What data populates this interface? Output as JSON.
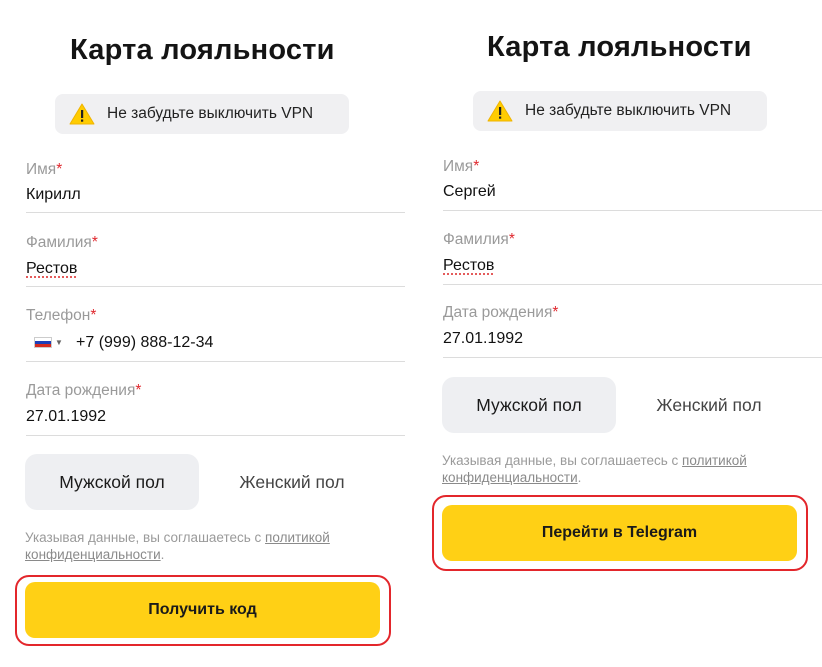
{
  "left": {
    "title": "Карта лояльности",
    "vpn_notice": "Не забудьте выключить VPN",
    "fields": {
      "first_name": {
        "label": "Имя",
        "value": "Кирилл"
      },
      "last_name": {
        "label": "Фамилия",
        "value": "Рестов"
      },
      "phone": {
        "label": "Телефон",
        "value": "+7 (999) 888-12-34"
      },
      "birthdate": {
        "label": "Дата рождения",
        "value": "27.01.1992"
      }
    },
    "required_mark": "*",
    "gender": {
      "male": "Мужской пол",
      "female": "Женский пол",
      "selected": "male"
    },
    "consent": {
      "text": "Указывая данные, вы соглашаетесь с ",
      "link": "политикой конфиденциальности",
      "end": "."
    },
    "cta": "Получить код"
  },
  "right": {
    "title": "Карта лояльности",
    "vpn_notice": "Не забудьте выключить VPN",
    "fields": {
      "first_name": {
        "label": "Имя",
        "value": "Сергей"
      },
      "last_name": {
        "label": "Фамилия",
        "value": "Рестов"
      },
      "birthdate": {
        "label": "Дата рождения",
        "value": "27.01.1992"
      }
    },
    "required_mark": "*",
    "gender": {
      "male": "Мужской пол",
      "female": "Женский пол",
      "selected": "male"
    },
    "consent": {
      "text": "Указывая данные, вы соглашаетесь с ",
      "link": "политикой конфиденциальности",
      "end": "."
    },
    "cta": "Перейти в Telegram"
  },
  "colors": {
    "accent": "#FFD015",
    "required": "#E0282E",
    "highlight_box": "#E3262B"
  },
  "icons": {
    "warning": "warning-triangle-icon",
    "flag": "russia-flag-icon"
  }
}
